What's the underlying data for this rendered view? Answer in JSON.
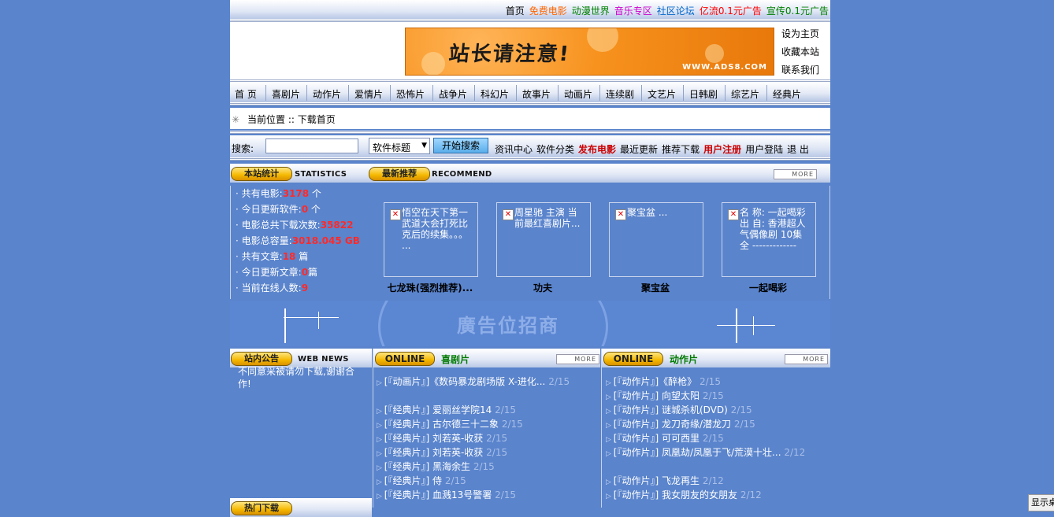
{
  "top_links": [
    {
      "label": "首页",
      "color": "#000000"
    },
    {
      "label": "免费电影",
      "color": "#ff6600"
    },
    {
      "label": "动漫世界",
      "color": "#008000"
    },
    {
      "label": "音乐专区",
      "color": "#cc00cc"
    },
    {
      "label": "社区论坛",
      "color": "#0066cc"
    },
    {
      "label": "亿流0.1元广告",
      "color": "#ff0000"
    },
    {
      "label": "宣传0.1元广告",
      "color": "#008000"
    }
  ],
  "banner": {
    "text": "站长请注意!",
    "url": "WWW.ADS8.COM"
  },
  "header_links": [
    "设为主页",
    "收藏本站",
    "联系我们"
  ],
  "nav": [
    "首 页",
    "喜剧片",
    "动作片",
    "爱情片",
    "恐怖片",
    "战争片",
    "科幻片",
    "故事片",
    "动画片",
    "连续剧",
    "文艺片",
    "日韩剧",
    "综艺片",
    "经典片"
  ],
  "location": {
    "label": "当前位置 :: 下载首页"
  },
  "search": {
    "label": "搜索:",
    "input_value": "",
    "select_value": "软件标题",
    "button": "开始搜索",
    "links": [
      {
        "label": "资讯中心",
        "color": "#000000"
      },
      {
        "label": "软件分类",
        "color": "#000000"
      },
      {
        "label": "发布电影",
        "color": "#cc0000"
      },
      {
        "label": "最近更新",
        "color": "#000000"
      },
      {
        "label": "推荐下载",
        "color": "#000000"
      },
      {
        "label": "用户注册",
        "color": "#cc0000"
      },
      {
        "label": "用户登陆",
        "color": "#000000"
      },
      {
        "label": "退 出",
        "color": "#000000"
      }
    ]
  },
  "statistics": {
    "title_cn": "本站统计",
    "title_en": "STATISTICS",
    "items": [
      {
        "label": "· 共有电影:",
        "value": "3178",
        "unit": " 个"
      },
      {
        "label": "· 今日更新软件:",
        "value": "0",
        "unit": " 个"
      },
      {
        "label": "· 电影总共下载次数:",
        "value": "35822",
        "unit": ""
      },
      {
        "label": "· 电影总容量:",
        "value": "3018.045 GB",
        "unit": ""
      },
      {
        "label": "· 共有文章:",
        "value": "18",
        "unit": " 篇"
      },
      {
        "label": "· 今日更新文章:",
        "value": "0",
        "unit": "篇"
      },
      {
        "label": "· 当前在线人数:",
        "value": "9",
        "unit": ""
      }
    ]
  },
  "recommend": {
    "title_cn": "最新推荐",
    "title_en": "RECOMMEND",
    "more": "MORE",
    "items": [
      {
        "text": "悟空在天下第一武道大会打死比克后的续集。。。 ...",
        "caption": "七龙珠(强烈推荐)..."
      },
      {
        "text": "周星驰 主演 当前最红喜剧片...",
        "caption": "功夫"
      },
      {
        "text": "聚宝盆 ...",
        "caption": "聚宝盆"
      },
      {
        "text": "名 称: 一起喝彩 出 自: 香港超人气偶像剧 10集全 -------------",
        "caption": "一起喝彩"
      }
    ]
  },
  "ad": {
    "text": "廣告位招商"
  },
  "news": {
    "title_cn": "站内公告",
    "title_en": "WEB NEWS",
    "text": "不同意采被请勿下载,谢谢合作!"
  },
  "comedy": {
    "online": "ONLINE",
    "title": "喜剧片",
    "more": "MORE",
    "rows": [
      {
        "text": "[『动画片』]《数码暴龙剧场版 X-进化...",
        "date": "2/15"
      },
      {
        "text": "[『经典片』] 爱丽丝学院14",
        "date": "2/15"
      },
      {
        "text": "[『经典片』] 古尔德三十二象",
        "date": "2/15"
      },
      {
        "text": "[『经典片』] 刘若英-收获",
        "date": "2/15"
      },
      {
        "text": "[『经典片』] 刘若英-收获",
        "date": "2/15"
      },
      {
        "text": "[『经典片』] 黑海余生",
        "date": "2/15"
      },
      {
        "text": "[『经典片』] 侍",
        "date": "2/15"
      },
      {
        "text": "[『经典片』] 血溅13号警署",
        "date": "2/15"
      }
    ]
  },
  "action": {
    "online": "ONLINE",
    "title": "动作片",
    "more": "MORE",
    "rows": [
      {
        "text": "[『动作片』]《醉枪》",
        "date": "2/15"
      },
      {
        "text": "[『动作片』] 向望太阳",
        "date": "2/15"
      },
      {
        "text": "[『动作片』] 谜城杀机(DVD)",
        "date": "2/15"
      },
      {
        "text": "[『动作片』] 龙刀奇缘/潜龙刀",
        "date": "2/15"
      },
      {
        "text": "[『动作片』] 可可西里",
        "date": "2/15"
      },
      {
        "text": "[『动作片』] 凤凰劫/凤凰于飞/荒漠十壮...",
        "date": "2/12"
      },
      {
        "text": "[『动作片』] 飞龙再生",
        "date": "2/12"
      },
      {
        "text": "[『动作片』] 我女朋友的女朋友",
        "date": "2/12"
      }
    ]
  },
  "hot": {
    "title_cn": "热门下载"
  },
  "status_button": "显示桌"
}
